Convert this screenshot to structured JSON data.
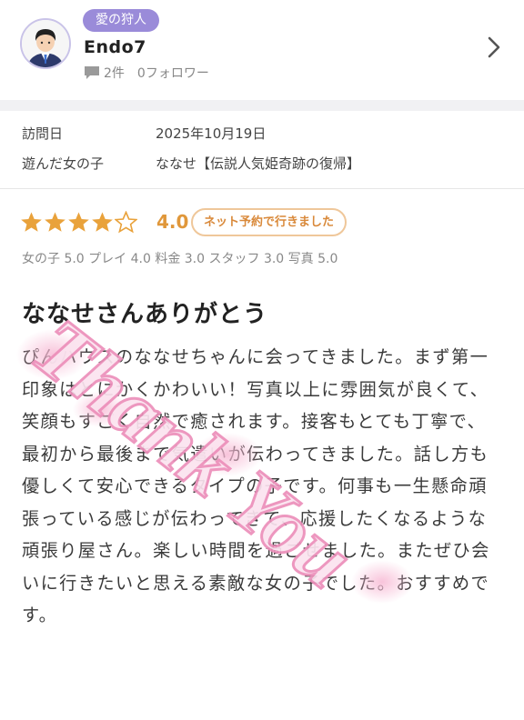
{
  "user": {
    "badge": "愛の狩人",
    "name": "Endo7",
    "post_count": "2件",
    "followers": "0フォロワー",
    "avatar_icon": "user-avatar-icon"
  },
  "info": {
    "visit_label": "訪問日",
    "visit_date": "2025年10月19日",
    "girl_label": "遊んだ女の子",
    "girl_value": "ななせ【伝説人気姫奇跡の復帰】"
  },
  "rating": {
    "stars_filled": 4,
    "stars_total": 5,
    "value": "4.0",
    "reservation_pill": "ネット予約で行きました",
    "scores": "女の子 5.0 プレイ 4.0 料金 3.0 スタッフ 3.0 写真 5.0"
  },
  "review": {
    "title": "ななせさんありがとう",
    "body": "ぴんハウスのななせちゃんに会ってきました。まず第一印象はとにかくかわいい！写真以上に雰囲気が良くて、笑顔もすごく自然で癒されます。接客もとても丁寧で、最初から最後まで気遣いが伝わってきました。話し方も優しくて安心できるタイプの子です。何事も一生懸命頑張っている感じが伝わってきて、応援したくなるような頑張り屋さん。楽しい時間を過ごせました。またぜひ会いに行きたいと思える素敵な女の子でした。おすすめです。"
  },
  "overlay": {
    "text": "Thank You"
  },
  "colors": {
    "star": "#e9a23b",
    "badge": "#9a8bd9",
    "overlay_pink": "#f29fc4"
  }
}
